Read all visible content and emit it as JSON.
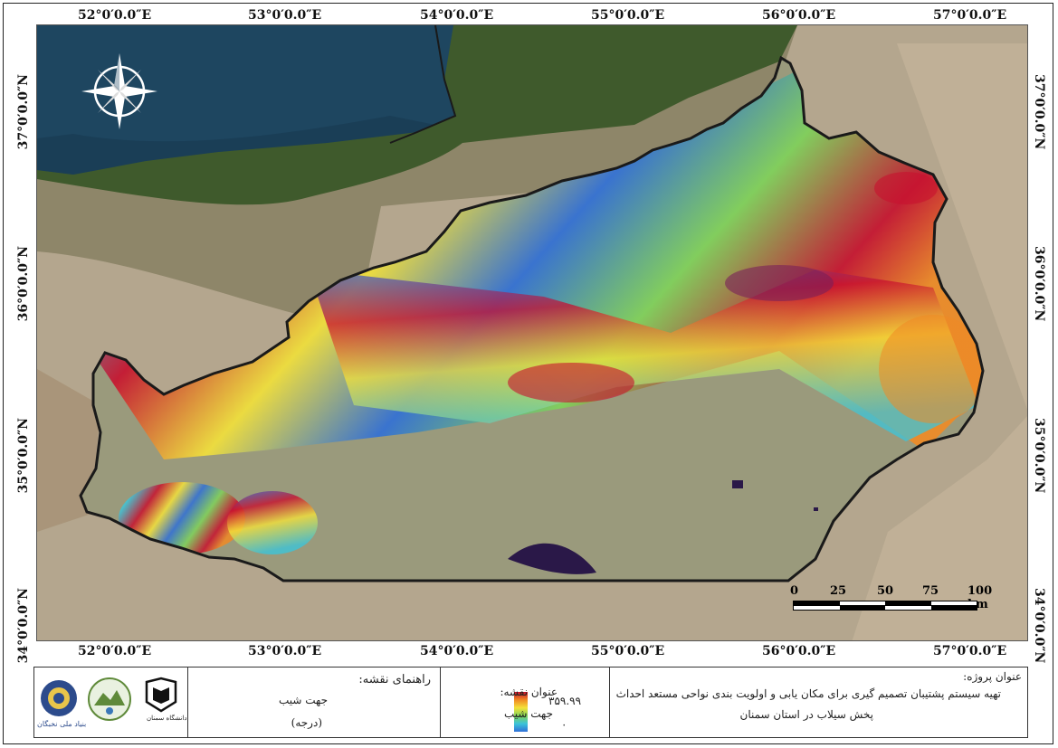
{
  "map": {
    "top_lon_labels": [
      "52°0′0.0″E",
      "53°0′0.0″E",
      "54°0′0.0″E",
      "55°0′0.0″E",
      "56°0′0.0″E",
      "57°0′0.0″E"
    ],
    "bottom_lon_labels": [
      "52°0′0.0″E",
      "53°0′0.0″E",
      "54°0′0.0″E",
      "55°0′0.0″E",
      "56°0′0.0″E",
      "57°0′0.0″E"
    ],
    "left_lat_labels": [
      "37°0′0.0″N",
      "36°0′0.0″N",
      "35°0′0.0″N",
      "34°0′0.0″N"
    ],
    "right_lat_labels": [
      "37°0′0.0″N",
      "36°0′0.0″N",
      "35°0′0.0″N",
      "34°0′0.0″N"
    ],
    "compass_icon": "north-arrow-compass-rose",
    "scale_bar": {
      "labels": [
        "0",
        "25",
        "50",
        "75",
        "100 km"
      ]
    }
  },
  "legend": {
    "project_heading": "عنوان پروژه:",
    "project_line1": "تهیه سیستم پشتیبان تصمیم گیری برای مکان یابی و اولویت بندی نواحی مستعد احداث",
    "project_line2": "پخش سیلاب در استان سمنان",
    "map_title_heading": "عنوان نقشه:",
    "map_title": "جهت شیب",
    "guide_heading": "راهنمای نقشه:",
    "guide_layer": "جهت شیب",
    "guide_unit": "(درجه)",
    "ramp_max": "۳۵۹.۹۹",
    "ramp_min": "۰",
    "logos": [
      {
        "icon": "semnan-university-logo",
        "caption": "دانشگاه سمنان"
      },
      {
        "icon": "province-emblem-logo",
        "caption": ""
      },
      {
        "icon": "national-elites-foundation-logo",
        "caption": "بنیاد ملی نخبگان"
      }
    ]
  },
  "colors": {
    "sea": "#1e4660",
    "forest": "#3f5a2c",
    "desert": "#b4a68e",
    "plain": "#9a9a7c",
    "salt_lake": "#2a1848"
  }
}
